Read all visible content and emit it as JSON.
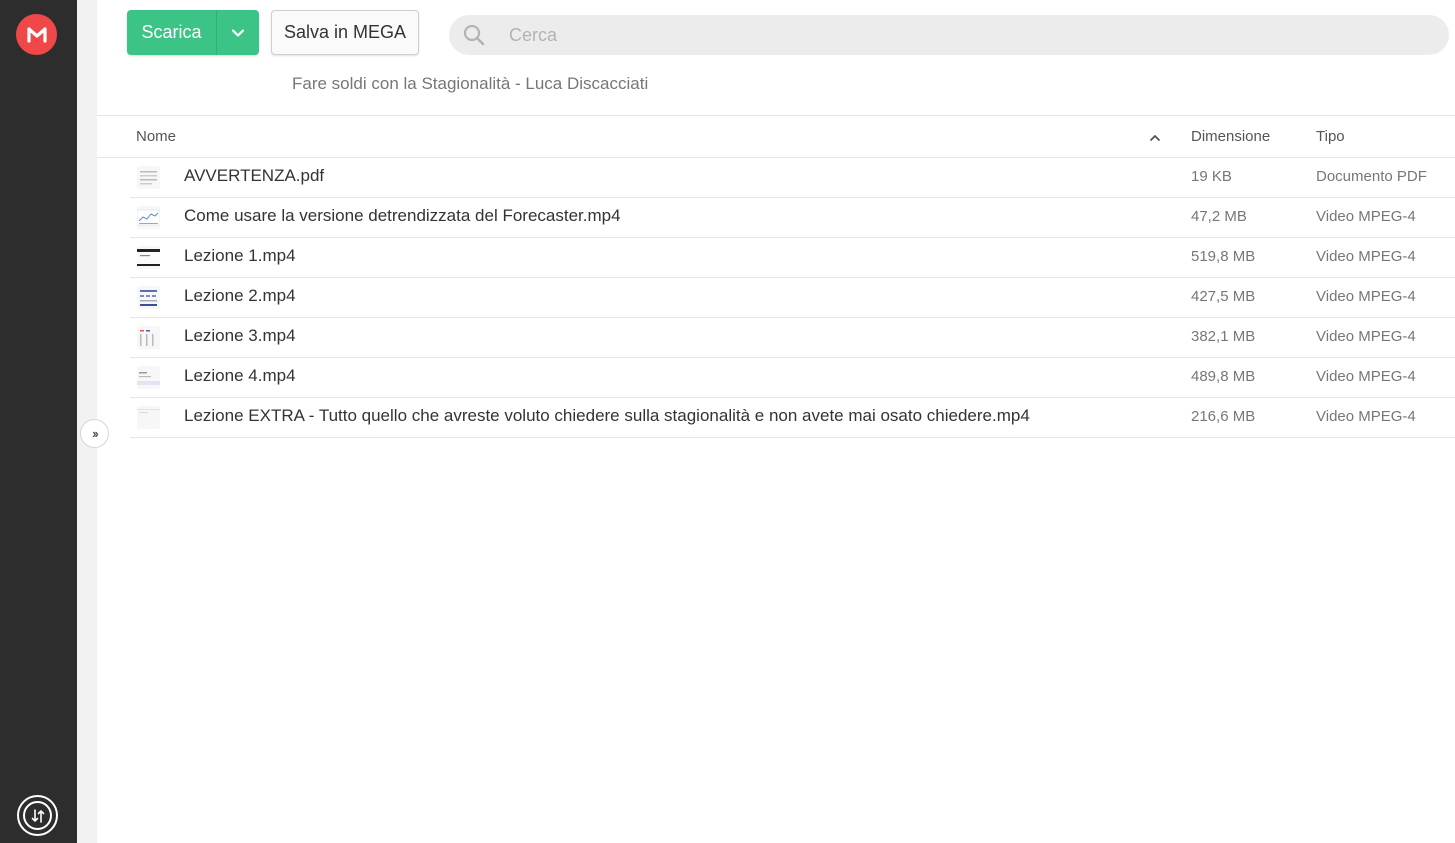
{
  "toolbar": {
    "download_label": "Scarica",
    "save_label": "Salva in MEGA"
  },
  "search": {
    "placeholder": "Cerca",
    "value": ""
  },
  "folder": {
    "title": "Fare soldi con la Stagionalità - Luca Discacciati"
  },
  "table": {
    "columns": {
      "name": "Nome",
      "size": "Dimensione",
      "type": "Tipo"
    },
    "sort": "name-ascending",
    "rows": [
      {
        "name": "AVVERTENZA.pdf",
        "size": "19 KB",
        "type": "Documento PDF",
        "thumb": "pdf-doc"
      },
      {
        "name": "Come usare la versione detrendizzata del Forecaster.mp4",
        "size": "47,2 MB",
        "type": "Video MPEG-4",
        "thumb": "chart"
      },
      {
        "name": "Lezione 1.mp4",
        "size": "519,8 MB",
        "type": "Video MPEG-4",
        "thumb": "dark-slide"
      },
      {
        "name": "Lezione 2.mp4",
        "size": "427,5 MB",
        "type": "Video MPEG-4",
        "thumb": "blue-table"
      },
      {
        "name": "Lezione 3.mp4",
        "size": "382,1 MB",
        "type": "Video MPEG-4",
        "thumb": "red-table"
      },
      {
        "name": "Lezione 4.mp4",
        "size": "489,8 MB",
        "type": "Video MPEG-4",
        "thumb": "light-slide"
      },
      {
        "name": "Lezione EXTRA - Tutto quello che avreste voluto chiedere sulla stagionalità e non avete mai osato chiedere.mp4",
        "size": "216,6 MB",
        "type": "Video MPEG-4",
        "thumb": "blank"
      }
    ]
  },
  "colors": {
    "rail": "#2d2d2d",
    "brand": "#f04848",
    "download": "#3cc487",
    "search_bg": "#ececec"
  },
  "icons": {
    "logo": "mega-logo-icon",
    "transfer": "transfer-icon",
    "expand": "expand-sidebar-icon",
    "search": "search-icon",
    "dropdown": "chevron-down-icon",
    "sort": "sort-ascending-icon"
  }
}
